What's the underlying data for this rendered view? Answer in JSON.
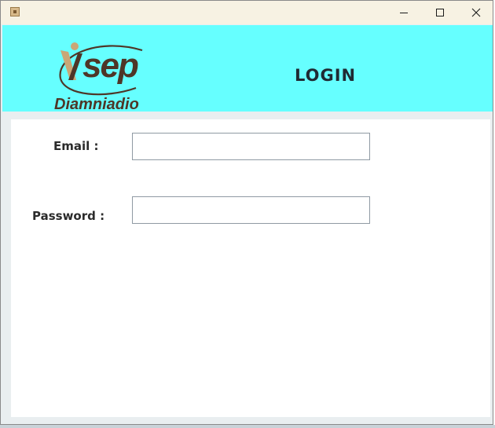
{
  "window": {
    "icon": "java-app-icon",
    "controls": [
      "minimize-icon",
      "maximize-icon",
      "close-icon"
    ]
  },
  "header": {
    "logo": {
      "brand": "isep",
      "subtitle": "Diamniadio"
    },
    "title": "LOGIN",
    "background": "#66ffff"
  },
  "form": {
    "email_label": "Email :",
    "email_value": "",
    "password_label": "Password :",
    "password_value": ""
  },
  "colors": {
    "logo_brown": "#4e3627",
    "logo_tan": "#c9a777",
    "title_text": "#1f2a33"
  }
}
